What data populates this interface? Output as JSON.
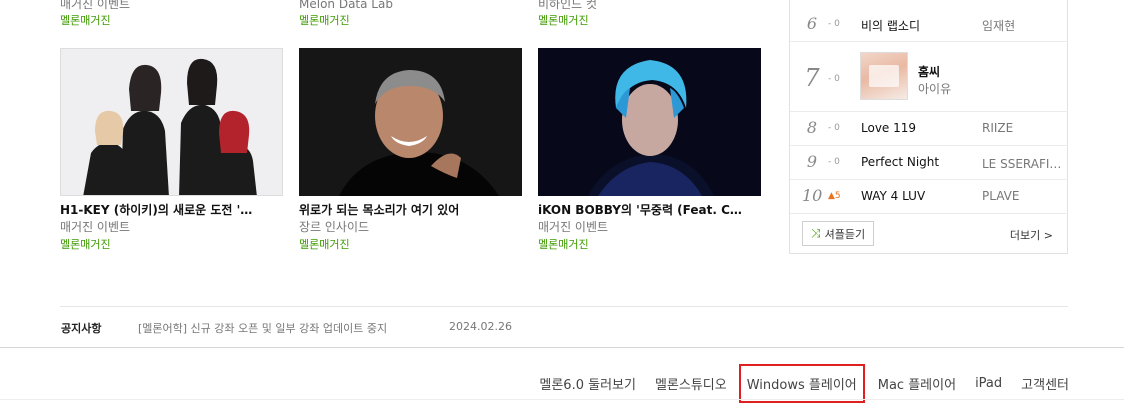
{
  "magazine": {
    "columns": [
      {
        "top_meta": "매거진 이벤트",
        "top_tag": "멜론매거진",
        "title": "H1-KEY (하이키)의 새로운 도전 '…",
        "category": "매거진 이벤트",
        "tag": "멜론매거진"
      },
      {
        "top_meta": "Melon Data Lab",
        "top_tag": "멜론매거진",
        "title": "위로가 되는 목소리가 여기 있어",
        "category": "장르 인사이드",
        "tag": "멜론매거진"
      },
      {
        "top_meta": "비하인드 컷",
        "top_tag": "멜론매거진",
        "title": "iKON BOBBY의 '무중력 (Feat. C…",
        "category": "매거진 이벤트",
        "tag": "멜론매거진"
      }
    ]
  },
  "chart": {
    "rows": [
      {
        "rank": "6",
        "delta": "- 0",
        "song": "비의 랩소디",
        "artist": "임재현"
      },
      {
        "rank": "7",
        "delta": "- 0",
        "song": "홈씨",
        "artist": "아이유"
      },
      {
        "rank": "8",
        "delta": "- 0",
        "song": "Love 119",
        "artist": "RIIZE"
      },
      {
        "rank": "9",
        "delta": "- 0",
        "song": "Perfect Night",
        "artist": "LE SSERAFIM (르세라핌)"
      },
      {
        "rank": "10",
        "delta": "▲5",
        "song": "WAY 4 LUV",
        "artist": "PLAVE"
      }
    ],
    "shuffle_label": "셔플듣기",
    "more_label": "더보기 >",
    "up_color": "#e9741c"
  },
  "notice": {
    "title": "공지사항",
    "text": "[멜론어학] 신규 강좌 오픈 및 일부 강좌 업데이트 중지",
    "date": "2024.02.26"
  },
  "footer": {
    "links": [
      "멜론6.0 둘러보기",
      "멜론스튜디오",
      "Windows 플레이어",
      "Mac 플레이어",
      "iPad",
      "고객센터"
    ],
    "highlight_color": "#e02020"
  }
}
